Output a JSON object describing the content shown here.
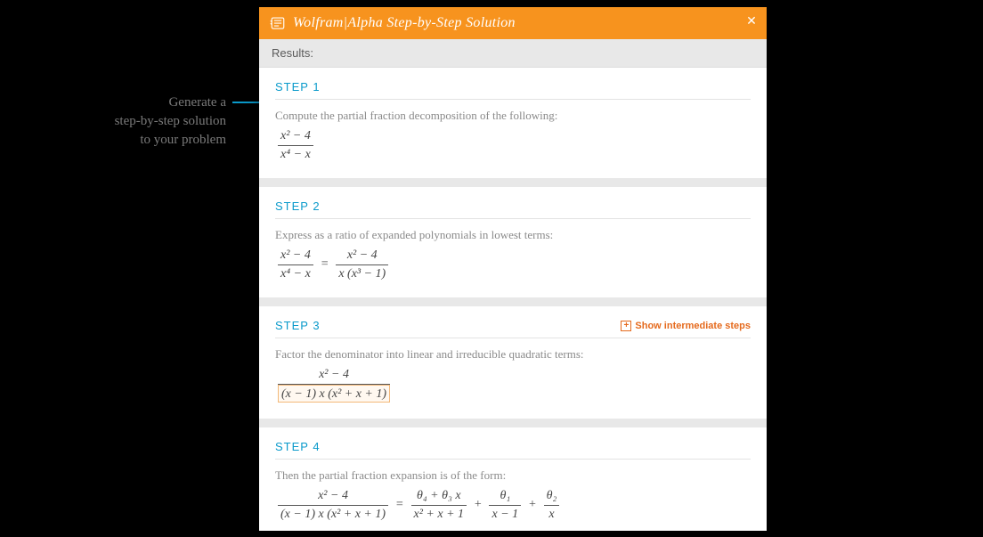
{
  "callout": {
    "line1": "Generate a",
    "line2": "step-by-step solution",
    "line3": "to your problem"
  },
  "panel": {
    "header_title": "Wolfram|Alpha Step-by-Step Solution",
    "close_glyph": "✕",
    "results_label": "Results:",
    "show_intermediate_label": "Show intermediate steps",
    "plus_glyph": "+"
  },
  "steps": [
    {
      "title": "STEP 1",
      "desc": "Compute the partial fraction decomposition of the following:",
      "frac_lhs_num": "x² − 4",
      "frac_lhs_den": "x⁴ − x"
    },
    {
      "title": "STEP 2",
      "desc": "Express as a ratio of expanded polynomials in lowest terms:",
      "frac_lhs_num": "x² − 4",
      "frac_lhs_den": "x⁴ − x",
      "frac_rhs_num": "x² − 4",
      "frac_rhs_den": "x (x³ − 1)",
      "eq": "="
    },
    {
      "title": "STEP 3",
      "show_intermediate": true,
      "desc": "Factor the denominator into linear and irreducible quadratic terms:",
      "frac_lhs_num": "x² − 4",
      "frac_lhs_den": "(x − 1) x (x² + x + 1)"
    },
    {
      "title": "STEP 4",
      "desc": "Then the partial fraction expansion is of the form:",
      "frac_lhs_num": "x² − 4",
      "frac_lhs_den": "(x − 1) x (x² + x + 1)",
      "eq": "=",
      "rhs_terms": [
        {
          "num": "θ₄ + θ₃ x",
          "den": "x² + x + 1"
        },
        {
          "num": "θ₁",
          "den": "x − 1"
        },
        {
          "num": "θ₂",
          "den": "x"
        }
      ],
      "plus": "+"
    }
  ]
}
